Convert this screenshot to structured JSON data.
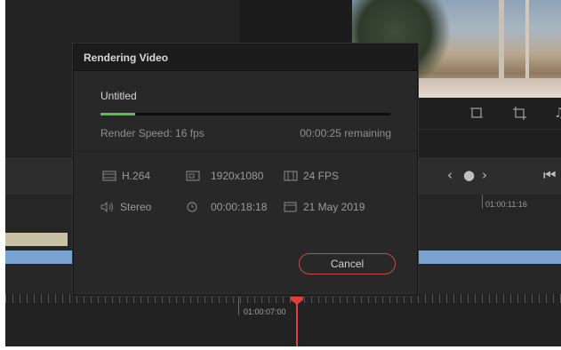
{
  "dialog": {
    "title": "Rendering Video",
    "job_name": "Untitled",
    "progress": 0.12,
    "render_speed": "Render Speed: 16 fps",
    "remaining": "00:00:25 remaining",
    "codec": "H.264",
    "resolution": "1920x1080",
    "frame_rate": "24 FPS",
    "audio": "Stereo",
    "duration": "00:00:18:18",
    "date": "21 May 2019",
    "cancel_label": "Cancel",
    "icons": {
      "codec": "film-strip-icon",
      "resolution": "resolution-icon",
      "frame_rate": "frame-rate-icon",
      "audio": "speaker-icon",
      "duration": "clock-icon",
      "date": "calendar-icon"
    }
  },
  "timeline": {
    "playhead_timecode": "01:00:07:00",
    "marker_timecode": "01:00:11:16"
  },
  "colors": {
    "progress": "#53c24f",
    "cancel_border": "#c94a44",
    "playhead": "#e0403a",
    "clip_video": "#7aa3d0",
    "clip_beige": "#c8c1a5"
  }
}
